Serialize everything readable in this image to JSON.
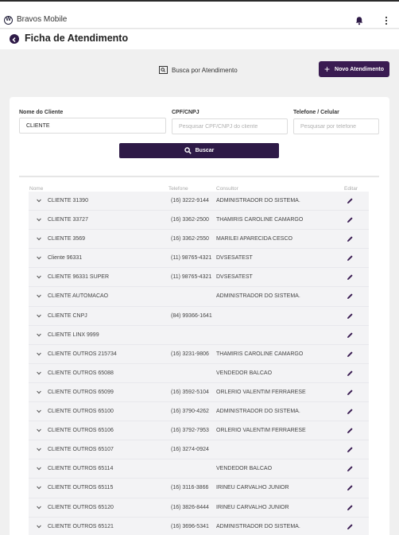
{
  "app": {
    "name": "Bravos Mobile"
  },
  "header": {
    "title": "Ficha de Atendimento"
  },
  "actions": {
    "busca_label": "Busca por Atendimento",
    "novo_label": "Novo Atendimento"
  },
  "filters": {
    "nome_label": "Nome do Cliente",
    "nome_value": "CLIENTE",
    "cpf_label": "CPF/CNPJ",
    "cpf_placeholder": "Pesquisar CPF/CNPJ do cliente",
    "telefone_label": "Telefone / Celular",
    "telefone_placeholder": "Pesquisar por telefone",
    "buscar_label": "Buscar"
  },
  "table": {
    "columns": {
      "nome": "Nome",
      "telefone": "Telefone",
      "consultor": "Consultor",
      "editar": "Editar"
    },
    "rows": [
      {
        "nome": "CLIENTE 31390",
        "telefone": "(16) 3222-9144",
        "consultor": "ADMINISTRADOR DO SISTEMA."
      },
      {
        "nome": "CLIENTE 33727",
        "telefone": "(16) 3362-2500",
        "consultor": "THAMIRIS CAROLINE CAMARGO"
      },
      {
        "nome": "CLIENTE 3569",
        "telefone": "(16) 3362-2550",
        "consultor": "MARILEI APARECIDA CESCO"
      },
      {
        "nome": "Cliente 96331",
        "telefone": "(11) 98765-4321",
        "consultor": "DVSESATEST"
      },
      {
        "nome": "CLIENTE 96331 SUPER",
        "telefone": "(11) 98765-4321",
        "consultor": "DVSESATEST"
      },
      {
        "nome": "CLIENTE AUTOMACAO",
        "telefone": "",
        "consultor": "ADMINISTRADOR DO SISTEMA."
      },
      {
        "nome": "CLIENTE CNPJ",
        "telefone": "(84) 99366-1641",
        "consultor": ""
      },
      {
        "nome": "CLIENTE LINX 9999",
        "telefone": "",
        "consultor": ""
      },
      {
        "nome": "CLIENTE OUTROS 215734",
        "telefone": "(16) 3231-9806",
        "consultor": "THAMIRIS CAROLINE CAMARGO"
      },
      {
        "nome": "CLIENTE OUTROS 65088",
        "telefone": "",
        "consultor": "VENDEDOR BALCAO"
      },
      {
        "nome": "CLIENTE OUTROS 65099",
        "telefone": "(16) 3592-5104",
        "consultor": "ORLERIO VALENTIM FERRARESE"
      },
      {
        "nome": "CLIENTE OUTROS 65100",
        "telefone": "(16) 3790-4262",
        "consultor": "ADMINISTRADOR DO SISTEMA."
      },
      {
        "nome": "CLIENTE OUTROS 65106",
        "telefone": "(16) 3792-7953",
        "consultor": "ORLERIO VALENTIM FERRARESE"
      },
      {
        "nome": "CLIENTE OUTROS 65107",
        "telefone": "(16) 3274-0924",
        "consultor": ""
      },
      {
        "nome": "CLIENTE OUTROS 65114",
        "telefone": "",
        "consultor": "VENDEDOR BALCAO"
      },
      {
        "nome": "CLIENTE OUTROS 65115",
        "telefone": "(16) 3116-3866",
        "consultor": "IRINEU CARVALHO JUNIOR"
      },
      {
        "nome": "CLIENTE OUTROS 65120",
        "telefone": "(16) 3826-8444",
        "consultor": "IRINEU CARVALHO JUNIOR"
      },
      {
        "nome": "CLIENTE OUTROS 65121",
        "telefone": "(16) 3696-5341",
        "consultor": "ADMINISTRADOR DO SISTEMA."
      }
    ]
  },
  "colors": {
    "primary": "#3a1c52",
    "dark_primary": "#2e1a47",
    "row_bg": "#f3f3f5"
  },
  "icons": [
    "vw-logo-icon",
    "bell-icon",
    "kebab-menu-icon",
    "back-arrow-icon",
    "search-document-icon",
    "plus-icon",
    "search-icon",
    "chevron-down-icon",
    "pencil-edit-icon"
  ]
}
